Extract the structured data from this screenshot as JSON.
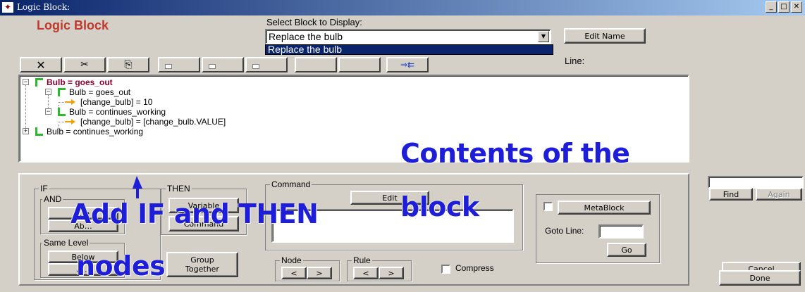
{
  "window": {
    "title": "Logic Block:",
    "minimize": "_",
    "maximize": "□",
    "close": "✕"
  },
  "header": {
    "logic_title": "Logic Block",
    "select_label": "Select Block to Display:",
    "selected_block": "Replace the bulb",
    "dropdown_option": "Replace the bulb",
    "edit_name": "Edit Name",
    "line_label": "Line:"
  },
  "toolbar": {
    "delete_icon": "✕",
    "cut_icon": "✂",
    "copy_icon": "⎘",
    "insert_icon": "⇒⇇"
  },
  "tree": [
    {
      "text": "Bulb = goes_out",
      "bold": true
    },
    {
      "text": "Bulb = goes_out"
    },
    {
      "text": "[change_bulb] = 10"
    },
    {
      "text": "Bulb = continues_working"
    },
    {
      "text": "[change_bulb] = [change_bulb.VALUE]"
    },
    {
      "text": "Bulb = continues_working"
    }
  ],
  "if_group": {
    "legend": "IF",
    "and_legend": "AND",
    "and_btn1": "…e",
    "and_btn2": "Ab…",
    "same_level_legend": "Same Level",
    "below": "Below",
    "above": "A…"
  },
  "then_group": {
    "legend": "THEN",
    "variable": "Variable",
    "command": "Command"
  },
  "group_together": {
    "line1": "Group",
    "line2": "Together"
  },
  "command_group": {
    "legend": "Command",
    "edit": "Edit"
  },
  "node_group": {
    "legend": "Node",
    "prev": "<",
    "next": ">"
  },
  "rule_group": {
    "legend": "Rule",
    "prev": "<",
    "next": ">"
  },
  "compress": "Compress",
  "metablock": {
    "label": "MetaBlock",
    "goto_line": "Goto Line:",
    "go": "Go"
  },
  "search": {
    "find": "Find",
    "again": "Again",
    "value": ""
  },
  "actions": {
    "cancel": "Cancel",
    "done": "Done"
  },
  "annotations": {
    "contents": "Contents of the",
    "block": "block",
    "add_if_then": "Add IF and THEN",
    "nodes": "nodes"
  },
  "colors": {
    "annotation": "#1e1ed8",
    "title_red": "#c0392b",
    "flag_green": "#2db82d",
    "flag_red": "#b22222",
    "arrow_orange": "#f5a000",
    "bold_node": "#8b0030"
  }
}
